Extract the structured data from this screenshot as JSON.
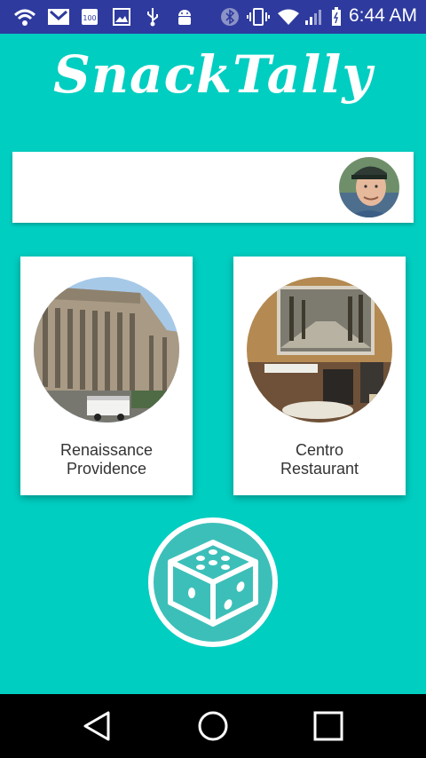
{
  "status_bar": {
    "time": "6:44 AM",
    "icons": [
      "wifi-call-icon",
      "gmail-icon",
      "badge-100-icon",
      "image-icon",
      "usb-icon",
      "android-icon",
      "bluetooth-icon",
      "vibrate-icon",
      "wifi-icon",
      "signal-icon",
      "battery-icon"
    ]
  },
  "app": {
    "title": "SnackTally",
    "accent_color": "#00CEC1",
    "status_color": "#2E3A9E"
  },
  "profile": {
    "avatar": "user-avatar"
  },
  "places": [
    {
      "name_line1": "Renaissance",
      "name_line2": "Providence"
    },
    {
      "name_line1": "Centro",
      "name_line2": "Restaurant"
    }
  ],
  "actions": {
    "random_icon": "dice-icon"
  },
  "nav": {
    "buttons": [
      "back-icon",
      "home-icon",
      "recents-icon"
    ]
  }
}
